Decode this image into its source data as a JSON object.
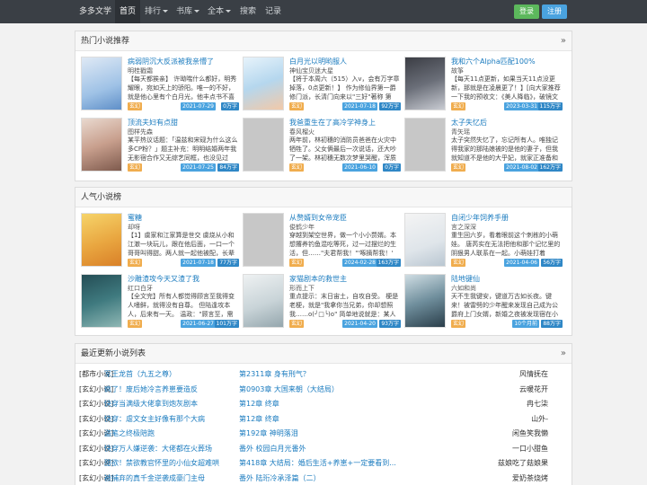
{
  "nav": {
    "brand": "多多文学",
    "items": [
      {
        "label": "首页",
        "active": true
      },
      {
        "label": "排行",
        "caret": true
      },
      {
        "label": "书库",
        "caret": true
      },
      {
        "label": "全本",
        "caret": true
      },
      {
        "label": "搜索"
      },
      {
        "label": "记录"
      }
    ],
    "login": "登录",
    "register": "注册"
  },
  "hot": {
    "title": "热门小说推荐",
    "books": [
      {
        "title": "病弱阴沉大反派被我亲懵了",
        "author": "明桂戳霜",
        "desc": "【每天都挨亲】 许呦喘什么都好，明秀耀眼，宛如天上的骄阳。唯一的不好，就是他心里有个白月光，他丰点书不喜",
        "tag": "玄幻",
        "date": "2021-07-29",
        "words": "0万字",
        "cover": "art-blue"
      },
      {
        "title": "白月光以明哟服人",
        "author": "神仙宝贝迷大星",
        "desc": "【将于本周六（515）入v，会有万字章掉落，0点更新！】 作为修仙界第一爵修门派，长清门向来以\"三好\"著称 第一，长",
        "tag": "玄幻",
        "date": "2021-07-18",
        "words": "92万字",
        "cover": "art-sky"
      },
      {
        "title": "我和六个Alpha匹配100%",
        "author": "故筝",
        "desc": "【每天11点更新，如果当天11点没更新，那就是在凌晨更了！】[向大家推荐一下我的预收文：《美人降临》，破镜文案：谢",
        "tag": "玄幻",
        "date": "2023-03-31",
        "words": "115万字",
        "cover": "art-dark"
      },
      {
        "title": "顶流夫妇有点甜",
        "author": "图样先森",
        "desc": "某平热议话题：「温兹和宋砚为什么这么多CP粉？」题主补充：明明结婚两年我无影宿合作又无综艺同框，也没见过",
        "tag": "玄幻",
        "date": "2021-07-25",
        "words": "84万字",
        "cover": "art-portrait"
      },
      {
        "title": "我爸重生在了高冷学神身上",
        "author": "春风榴火",
        "desc": "两年前，林初穗的消防员爸爸在火灾中牺牲了。父女俩最后一次说话，还大吵了一架。林初穗无数次梦里哭醒，浑质",
        "tag": "玄幻",
        "date": "2021-06-10",
        "words": "0万字",
        "cover": "none"
      },
      {
        "title": "太子失忆后",
        "author": "青矢瑶",
        "desc": "太子突然失忆了，忘记所有人。唯独记得我家的那陆娘被的是他的妻子，但我就知道不是他的大乎妃，就家正准备和三皇子议",
        "tag": "玄幻",
        "date": "2021-08-02",
        "words": "162万字",
        "cover": "none"
      }
    ]
  },
  "popular": {
    "title": "人气小说榜",
    "books": [
      {
        "title": "蜜糖",
        "author": "却呀",
        "desc": "【1】虞家和江家算是世交 虞烧从小和江澈一块玩儿，跟在他后面，一口一个哥哥叫得甜。两人就一起他被配，长辈",
        "tag": "玄幻",
        "date": "2021-07-18",
        "words": "77万字",
        "cover": "art-orange"
      },
      {
        "title": "从赘婿到女帝宠臣",
        "author": "俊鹤少年",
        "desc": "穿越到架空世界，做一个小小赘婿。本想撂养钓鱼混吃等死，过一过摆烂的生活，但……\"夫君帮我！\"'啄摘帮我！'",
        "tag": "玄幻",
        "date": "2024-02-28",
        "words": "163万字",
        "cover": "none"
      },
      {
        "title": "自闭少年饲养手册",
        "author": "言之深深",
        "desc": "重生回六岁，看着眼前这个刺栋的小萌娃。 唐芮实在无法把他和那个记忆里的阴狠男人联系在一起。小萌娃打着她：\"只",
        "tag": "玄幻",
        "date": "2021-04-06",
        "words": "56万字",
        "cover": "art-light"
      },
      {
        "title": "沙雕渣攻今天又渣了我",
        "author": "红口白牙",
        "desc": "【全文完】所有人都觉得顾言至我得变人嗜鲜，就得没有自尊。 但陆逢攻本人，后来有一天。 温政：\"顾言至，需",
        "tag": "玄幻",
        "date": "2021-06-27",
        "words": "101万字",
        "cover": "art-teal"
      },
      {
        "title": "家猫剧本的救世主",
        "author": "形而上下",
        "desc": "重点提示：末日宙土，自攻自受。 梗是老梗，就是\"我拿你当兄弟，你却想照我……o(╯□╰)o\" 简单地说就是：某人",
        "tag": "玄幻",
        "date": "2021-04-20",
        "words": "93万字",
        "cover": "art-mist"
      },
      {
        "title": "陆地键仙",
        "author": "六如和尚",
        "desc": "天不生我键安，键道万古如长夜。键来！被雷劈的少年醒来发现自己成为公爵府上门女婿，新婚之夜被发现宿在小姨子床",
        "tag": "玄幻",
        "date": "10个月前",
        "words": "88万字",
        "cover": "art-ink"
      }
    ]
  },
  "updates": {
    "title": "最近更新小说列表",
    "rows": [
      {
        "cat": "[都市小说]",
        "name": "军王龙首（九五之尊）",
        "chapter": "第2311章 身有刑气？",
        "author": "风情抚在"
      },
      {
        "cat": "[玄幻小说]",
        "name": "疯了！废后她冷言养崽要造反",
        "chapter": "第0903章 大国来朝（大结局）",
        "author": "云暖花开"
      },
      {
        "cat": "[玄幻小说]",
        "name": "快穿当满级大佬拿到炮灰剧本",
        "chapter": "第12章 终章",
        "author": "冉七柒"
      },
      {
        "cat": "[玄幻小说]",
        "name": "快穿：虐文女主好像有那个大病",
        "chapter": "第12章 终章",
        "author": "山外-"
      },
      {
        "cat": "[玄幻小说]",
        "name": "盗笔之终极陪跑",
        "chapter": "第192章 神明落泪",
        "author": "闲鱼笑我懒"
      },
      {
        "cat": "[玄幻小说]",
        "name": "快穿万人嫌逆袭：大佬都在火葬场",
        "chapter": "番外 校园白月光番外",
        "author": "一口小甜鱼"
      },
      {
        "cat": "[玄幻小说]",
        "name": "甜欲！禁欲教官怀里的小仙女超难哄",
        "chapter": "第418章 大结局：婚后生活+养崽+一定要看到...",
        "author": "兹娘吃了菇娘果"
      },
      {
        "cat": "[玄幻小说]",
        "name": "被捕弃的真千金逆袭成豪门主母",
        "chapter": "番外 陆珩冷承泽篇（二）",
        "author": "爱奶茶烧烤"
      }
    ]
  }
}
